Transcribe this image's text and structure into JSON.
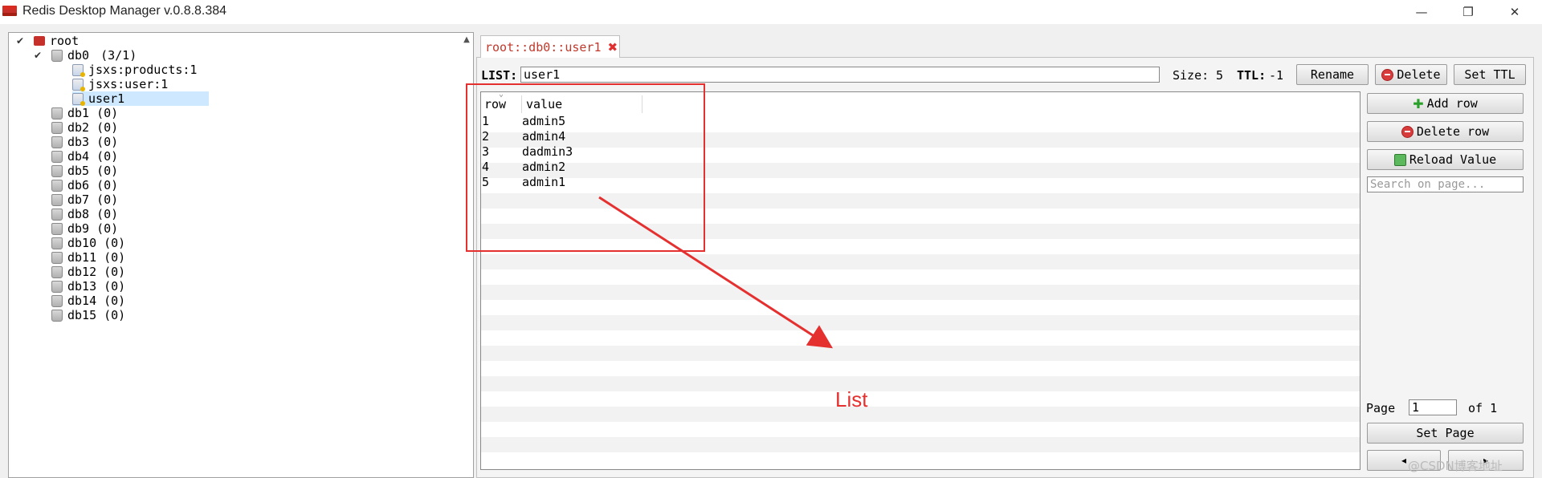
{
  "window": {
    "title": "Redis Desktop Manager v.0.8.8.384",
    "controls": [
      "minimize-icon",
      "restore-icon",
      "close-icon"
    ]
  },
  "tree": {
    "root": "root",
    "db0": {
      "label": "db0",
      "count": "(3/1)"
    },
    "keys": [
      "jsxs:products:1",
      "jsxs:user:1",
      "user1"
    ],
    "dbs": [
      {
        "label": "db1",
        "count": "(0)"
      },
      {
        "label": "db2",
        "count": "(0)"
      },
      {
        "label": "db3",
        "count": "(0)"
      },
      {
        "label": "db4",
        "count": "(0)"
      },
      {
        "label": "db5",
        "count": "(0)"
      },
      {
        "label": "db6",
        "count": "(0)"
      },
      {
        "label": "db7",
        "count": "(0)"
      },
      {
        "label": "db8",
        "count": "(0)"
      },
      {
        "label": "db9",
        "count": "(0)"
      },
      {
        "label": "db10",
        "count": "(0)"
      },
      {
        "label": "db11",
        "count": "(0)"
      },
      {
        "label": "db12",
        "count": "(0)"
      },
      {
        "label": "db13",
        "count": "(0)"
      },
      {
        "label": "db14",
        "count": "(0)"
      },
      {
        "label": "db15",
        "count": "(0)"
      }
    ]
  },
  "tab": {
    "label": "root::db0::user1",
    "close": "✖"
  },
  "key": {
    "type_label": "LIST:",
    "name": "user1",
    "size_label": "Size:",
    "size": "5",
    "ttl_label": "TTL:",
    "ttl": "-1"
  },
  "buttons": {
    "rename": "Rename",
    "delete": "Delete",
    "set_ttl": "Set TTL",
    "add_row": "Add row",
    "delete_row": "Delete row",
    "reload_value": "Reload Value",
    "set_page": "Set Page"
  },
  "table": {
    "headers": [
      "row",
      "value"
    ],
    "rows": [
      {
        "row": "1",
        "value": "admin5"
      },
      {
        "row": "2",
        "value": "admin4"
      },
      {
        "row": "3",
        "value": "dadmin3"
      },
      {
        "row": "4",
        "value": "admin2"
      },
      {
        "row": "5",
        "value": "admin1"
      }
    ]
  },
  "search": {
    "placeholder": "Search on page..."
  },
  "pagination": {
    "page_label": "Page",
    "page": "1",
    "of_label": "of 1"
  },
  "annotation": {
    "text": "List",
    "color": "#e53030"
  },
  "watermark": "@CSDN博客地址"
}
